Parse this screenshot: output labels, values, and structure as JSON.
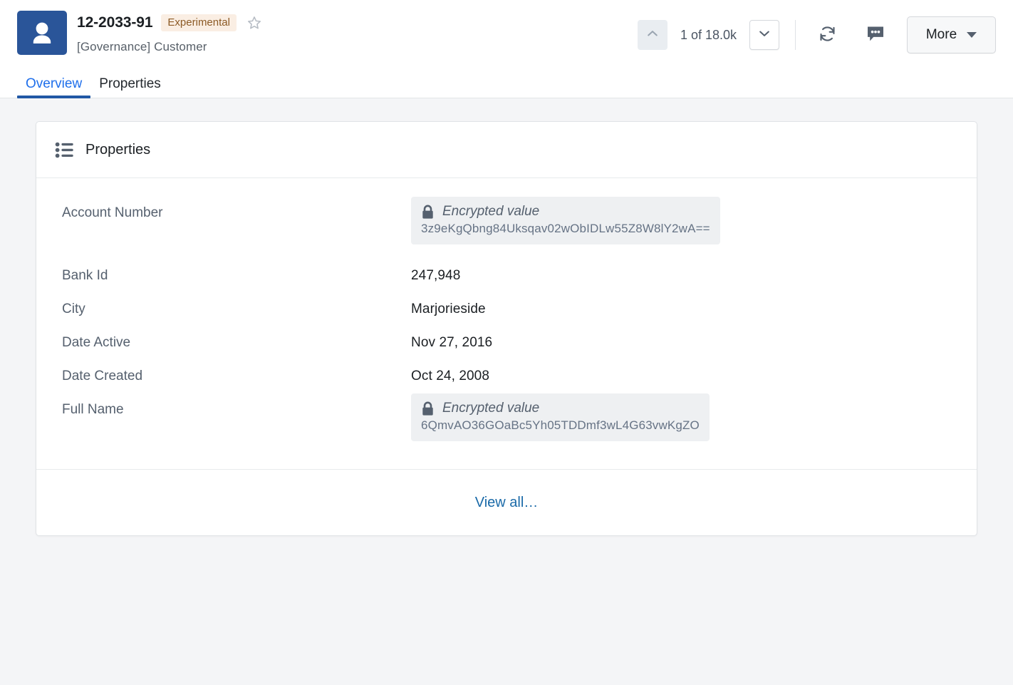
{
  "header": {
    "avatar_icon": "person-avatar-icon",
    "entity_id": "12-2033-91",
    "badge": "Experimental",
    "star_icon": "star-outline-icon",
    "subtitle": "[Governance] Customer",
    "pager": {
      "prev_icon": "chevron-up-icon",
      "label": "1 of 18.0k",
      "next_icon": "chevron-down-icon"
    },
    "refresh_icon": "refresh-sync-icon",
    "comment_icon": "comment-bubble-icon",
    "more_label": "More",
    "more_caret_icon": "caret-down-icon"
  },
  "tabs": [
    {
      "label": "Overview",
      "active": true
    },
    {
      "label": "Properties",
      "active": false
    }
  ],
  "card": {
    "icon": "bulleted-list-icon",
    "title": "Properties",
    "rows": [
      {
        "label": "Account Number",
        "type": "encrypted",
        "encrypted_label": "Encrypted value",
        "hash": "3z9eKgQbng84Uksqav02wObIDLw55Z8W8lY2wA=="
      },
      {
        "label": "Bank Id",
        "type": "text",
        "value": "247,948"
      },
      {
        "label": "City",
        "type": "text",
        "value": "Marjorieside"
      },
      {
        "label": "Date Active",
        "type": "text",
        "value": "Nov 27, 2016"
      },
      {
        "label": "Date Created",
        "type": "text",
        "value": "Oct 24, 2008"
      },
      {
        "label": "Full Name",
        "type": "encrypted",
        "encrypted_label": "Encrypted value",
        "hash": "6QmvAO36GOaBc5Yh05TDDmf3wL4G63vwKgZO"
      }
    ],
    "footer_link": "View all…"
  },
  "colors": {
    "accent_blue": "#1f6feb",
    "tab_underline": "#2158a5",
    "avatar_bg": "#2a5599",
    "badge_bg": "#faeee3",
    "badge_text": "#8c5a25",
    "link": "#1a6aa8",
    "page_bg": "#f4f5f7"
  }
}
